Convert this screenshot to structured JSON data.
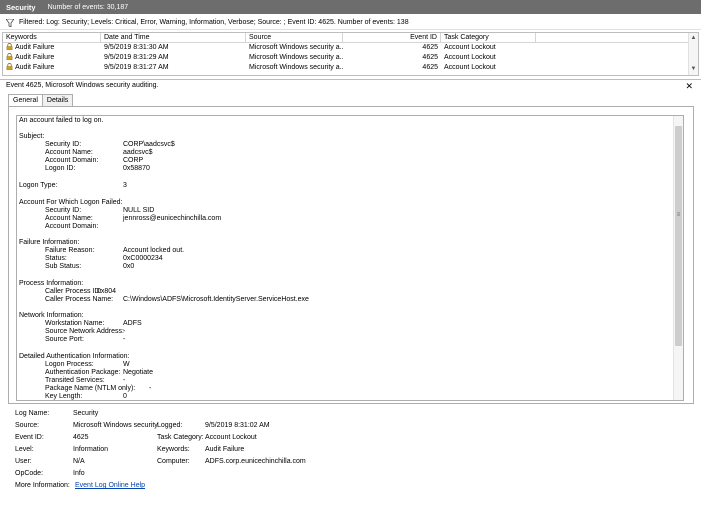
{
  "titlebar": {
    "title": "Security",
    "count": "Number of events: 30,187"
  },
  "filter": {
    "text": "Filtered: Log: Security; Levels: Critical, Error, Warning, Information, Verbose; Source: ; Event ID: 4625. Number of events: 138"
  },
  "grid": {
    "headers": [
      "Keywords",
      "Date and Time",
      "Source",
      "Event ID",
      "Task Category"
    ],
    "rows": [
      {
        "keywords": "Audit Failure",
        "datetime": "9/5/2019 8:31:30 AM",
        "source": "Microsoft Windows security a...",
        "eventid": "4625",
        "category": "Account Lockout"
      },
      {
        "keywords": "Audit Failure",
        "datetime": "9/5/2019 8:31:29 AM",
        "source": "Microsoft Windows security a...",
        "eventid": "4625",
        "category": "Account Lockout"
      },
      {
        "keywords": "Audit Failure",
        "datetime": "9/5/2019 8:31:27 AM",
        "source": "Microsoft Windows security a...",
        "eventid": "4625",
        "category": "Account Lockout"
      }
    ]
  },
  "event_header": "Event 4625, Microsoft Windows security auditing.",
  "tabs": [
    "General",
    "Details"
  ],
  "description": {
    "intro": "An account failed to log on.",
    "subject_heading": "Subject:",
    "subject": [
      {
        "label": "Security ID:",
        "value": "CORP\\aadcsvc$"
      },
      {
        "label": "Account Name:",
        "value": "aadcsvc$"
      },
      {
        "label": "Account Domain:",
        "value": "CORP"
      },
      {
        "label": "Logon ID:",
        "value": "0x58870"
      }
    ],
    "logon_type": {
      "label": "Logon Type:",
      "value": "3"
    },
    "failed_heading": "Account For Which Logon Failed:",
    "failed": [
      {
        "label": "Security ID:",
        "value": "NULL SID"
      },
      {
        "label": "Account Name:",
        "value": "jennross@eunicechinchilla.com"
      },
      {
        "label": "Account Domain:",
        "value": ""
      }
    ],
    "failure_heading": "Failure Information:",
    "failure": [
      {
        "label": "Failure Reason:",
        "value": "Account locked out."
      },
      {
        "label": "Status:",
        "value": "0xC0000234"
      },
      {
        "label": "Sub Status:",
        "value": "0x0"
      }
    ],
    "process_heading": "Process Information:",
    "process": [
      {
        "label": "Caller Process ID:",
        "value": "0x804"
      },
      {
        "label": "Caller Process Name:",
        "value": "C:\\Windows\\ADFS\\Microsoft.IdentityServer.ServiceHost.exe"
      }
    ],
    "network_heading": "Network Information:",
    "network": [
      {
        "label": "Workstation Name:",
        "value": "ADFS"
      },
      {
        "label": "Source Network Address:",
        "value": "-"
      },
      {
        "label": "Source Port:",
        "value": "-"
      }
    ],
    "auth_heading": "Detailed Authentication Information:",
    "auth": [
      {
        "label": "Logon Process:",
        "value": "W"
      },
      {
        "label": "Authentication Package:",
        "value": "Negotiate"
      },
      {
        "label": "Transited Services:",
        "value": "-"
      },
      {
        "label": "Package Name (NTLM only):",
        "value": "-"
      },
      {
        "label": "Key Length:",
        "value": "0"
      }
    ]
  },
  "details": {
    "log_name": {
      "label": "Log Name:",
      "value": "Security"
    },
    "source": {
      "label": "Source:",
      "value": "Microsoft Windows security"
    },
    "logged": {
      "label": "Logged:",
      "value": "9/5/2019 8:31:02 AM"
    },
    "event_id": {
      "label": "Event ID:",
      "value": "4625"
    },
    "task_category": {
      "label": "Task Category:",
      "value": "Account Lockout"
    },
    "level": {
      "label": "Level:",
      "value": "Information"
    },
    "keywords": {
      "label": "Keywords:",
      "value": "Audit Failure"
    },
    "user": {
      "label": "User:",
      "value": "N/A"
    },
    "computer": {
      "label": "Computer:",
      "value": "ADFS.corp.eunicechinchilla.com"
    },
    "opcode": {
      "label": "OpCode:",
      "value": "Info"
    },
    "more_info": {
      "label": "More Information:",
      "value": "Event Log Online Help"
    }
  },
  "colors": {
    "titlebar": "#6d6d6d",
    "link": "#0645ad",
    "lock": "#d4a017"
  }
}
